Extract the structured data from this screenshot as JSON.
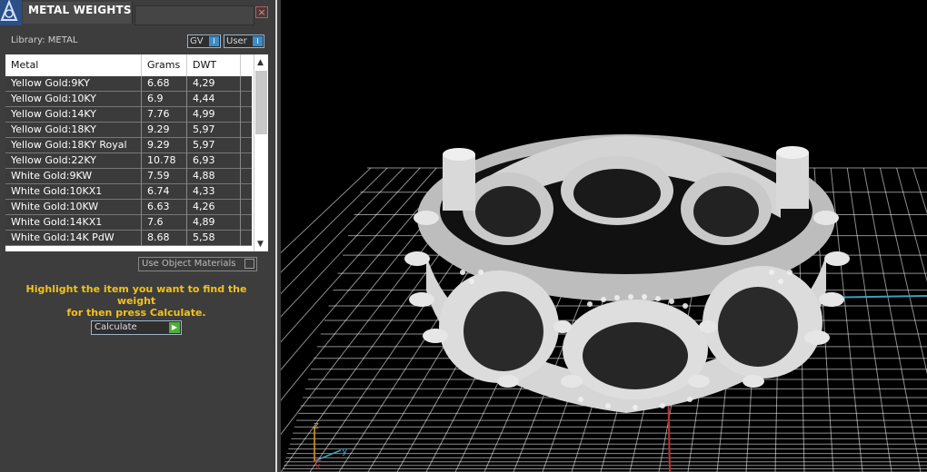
{
  "panel": {
    "title": "METAL WEIGHTS",
    "close_glyph": "×",
    "library_label": "Library: METAL",
    "toggles": {
      "gv": "GV",
      "user": "User"
    },
    "table": {
      "headers": [
        "Metal",
        "Grams",
        "DWT"
      ],
      "rows": [
        [
          "Yellow Gold:9KY",
          "6.68",
          "4,29"
        ],
        [
          "Yellow Gold:10KY",
          "6.9",
          "4,44"
        ],
        [
          "Yellow Gold:14KY",
          "7.76",
          "4,99"
        ],
        [
          "Yellow Gold:18KY",
          "9.29",
          "5,97"
        ],
        [
          "Yellow Gold:18KY Royal",
          "9.29",
          "5,97"
        ],
        [
          "Yellow Gold:22KY",
          "10.78",
          "6,93"
        ],
        [
          "White Gold:9KW",
          "7.59",
          "4,88"
        ],
        [
          "White Gold:10KX1",
          "6.74",
          "4,33"
        ],
        [
          "White Gold:10KW",
          "6.63",
          "4,26"
        ],
        [
          "White Gold:14KX1",
          "7.6",
          "4,89"
        ],
        [
          "White Gold:14K PdW",
          "8.68",
          "5,58"
        ]
      ]
    },
    "use_object_materials": "Use Object Materials",
    "instruction_line1": "Highlight the item you want to find the weight",
    "instruction_line2": "for then press Calculate.",
    "calculate_label": "Calculate"
  },
  "viewport": {
    "axis_labels": {
      "z": "z",
      "y": "y",
      "x": "x"
    },
    "colors": {
      "grid": "#ffffff",
      "model": "#d9d9d9",
      "x_axis": "#c03030",
      "y_axis": "#3aa0c0",
      "instruction": "#f2c21b"
    }
  }
}
